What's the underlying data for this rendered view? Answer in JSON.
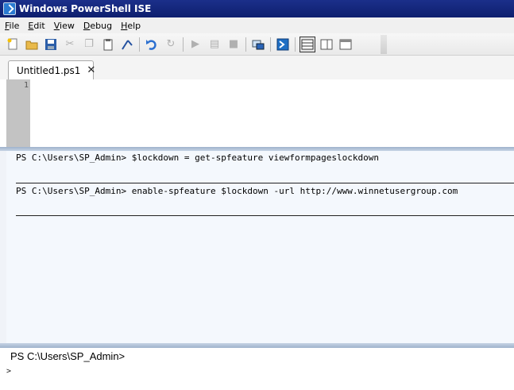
{
  "window": {
    "title": "Windows PowerShell ISE"
  },
  "menu": [
    {
      "label": "File",
      "key": "F",
      "rest": "ile"
    },
    {
      "label": "Edit",
      "key": "E",
      "rest": "dit"
    },
    {
      "label": "View",
      "key": "V",
      "rest": "iew"
    },
    {
      "label": "Debug",
      "key": "D",
      "rest": "ebug"
    },
    {
      "label": "Help",
      "key": "H",
      "rest": "elp"
    }
  ],
  "toolbar": {
    "icons": [
      "new-file-icon",
      "open-folder-icon",
      "save-icon",
      "cut-icon",
      "copy-icon",
      "paste-icon",
      "clear-icon",
      "undo-icon",
      "redo-icon",
      "run-icon",
      "run-selection-icon",
      "stop-icon",
      "remote-powershell-icon",
      "start-powershell-icon",
      "layout-top-icon",
      "layout-right-icon",
      "layout-max-icon"
    ]
  },
  "tabs": [
    {
      "label": "Untitled1.ps1",
      "active": true
    }
  ],
  "editor": {
    "line_numbers": [
      "1"
    ]
  },
  "output": {
    "lines": [
      "PS C:\\Users\\SP_Admin> $lockdown = get-spfeature viewformpageslockdown",
      "PS C:\\Users\\SP_Admin> enable-spfeature $lockdown -url http://www.winnetusergroup.com"
    ]
  },
  "command": {
    "prompt": "PS C:\\Users\\SP_Admin>",
    "input_marker": ">"
  },
  "colors": {
    "titlebar": "#0e1f6e",
    "output_bg": "#f4f8fd",
    "gutter": "#c3c3c3"
  }
}
